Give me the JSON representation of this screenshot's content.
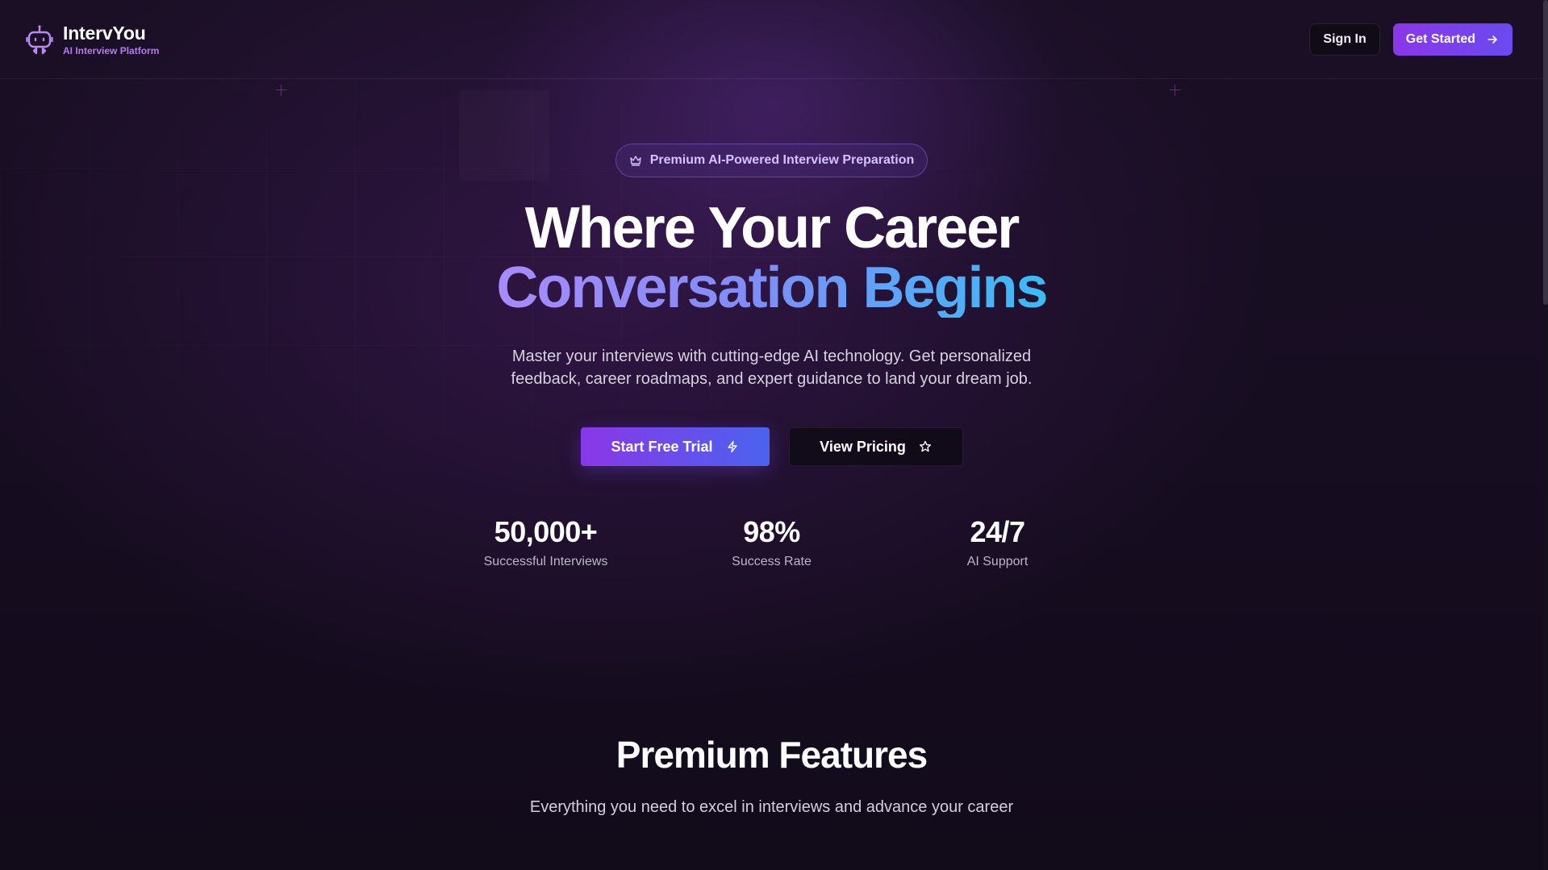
{
  "brand": {
    "name": "IntervYou",
    "tagline": "AI Interview Platform",
    "logo_icon": "robot-icon"
  },
  "header": {
    "signin_label": "Sign In",
    "getstarted_label": "Get Started",
    "getstarted_icon": "arrow-right-icon"
  },
  "hero": {
    "badge_icon": "crown-icon",
    "badge_text": "Premium AI-Powered Interview Preparation",
    "headline_line1": "Where Your Career",
    "headline_line2": "Conversation Begins",
    "subtitle": "Master your interviews with cutting-edge AI technology. Get personalized feedback, career roadmaps, and expert guidance to land your dream job.",
    "primary_cta": "Start Free Trial",
    "primary_cta_icon": "lightning-icon",
    "secondary_cta": "View Pricing",
    "secondary_cta_icon": "star-icon"
  },
  "stats": [
    {
      "value": "50,000+",
      "label": "Successful Interviews"
    },
    {
      "value": "98%",
      "label": "Success Rate"
    },
    {
      "value": "24/7",
      "label": "AI Support"
    }
  ],
  "features": {
    "title": "Premium Features",
    "subtitle": "Everything you need to excel in interviews and advance your career"
  },
  "colors": {
    "background": "#170d21",
    "accent_purple": "#8a37e8",
    "accent_blue": "#4b63ee",
    "gradient_text_start": "#a78bfa",
    "gradient_text_end": "#38bdf8",
    "brand_tag": "#b57cf0"
  }
}
